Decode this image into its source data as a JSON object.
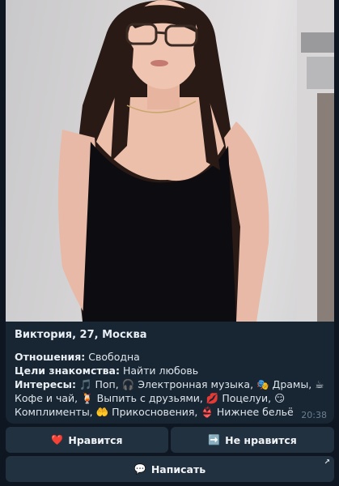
{
  "profile": {
    "title": "Виктория, 27, Москва",
    "relationship_label": "Отношения:",
    "relationship_value": "Свободна",
    "goal_label": "Цели знакомства:",
    "goal_value": "Найти любовь",
    "interests_label": "Интересы:",
    "interests_text": "🎵 Поп, 🎧 Электронная музыка, 🎭 Драмы, ☕ Кофе и чай, 🍹 Выпить с друзьями, 💋 Поцелуи, 😏 Комплименты, 🤲 Прикосновения, 👙 Нижнее бельё",
    "time": "20:38"
  },
  "buttons": {
    "like_icon": "❤️",
    "like_label": "Нравится",
    "dislike_icon": "➡️",
    "dislike_label": "Не нравится",
    "write_icon": "💬",
    "write_label": "Написать",
    "write_corner_icon": "↗"
  },
  "colors": {
    "background": "#0e1621",
    "card": "#182533",
    "button": "#22313f"
  }
}
